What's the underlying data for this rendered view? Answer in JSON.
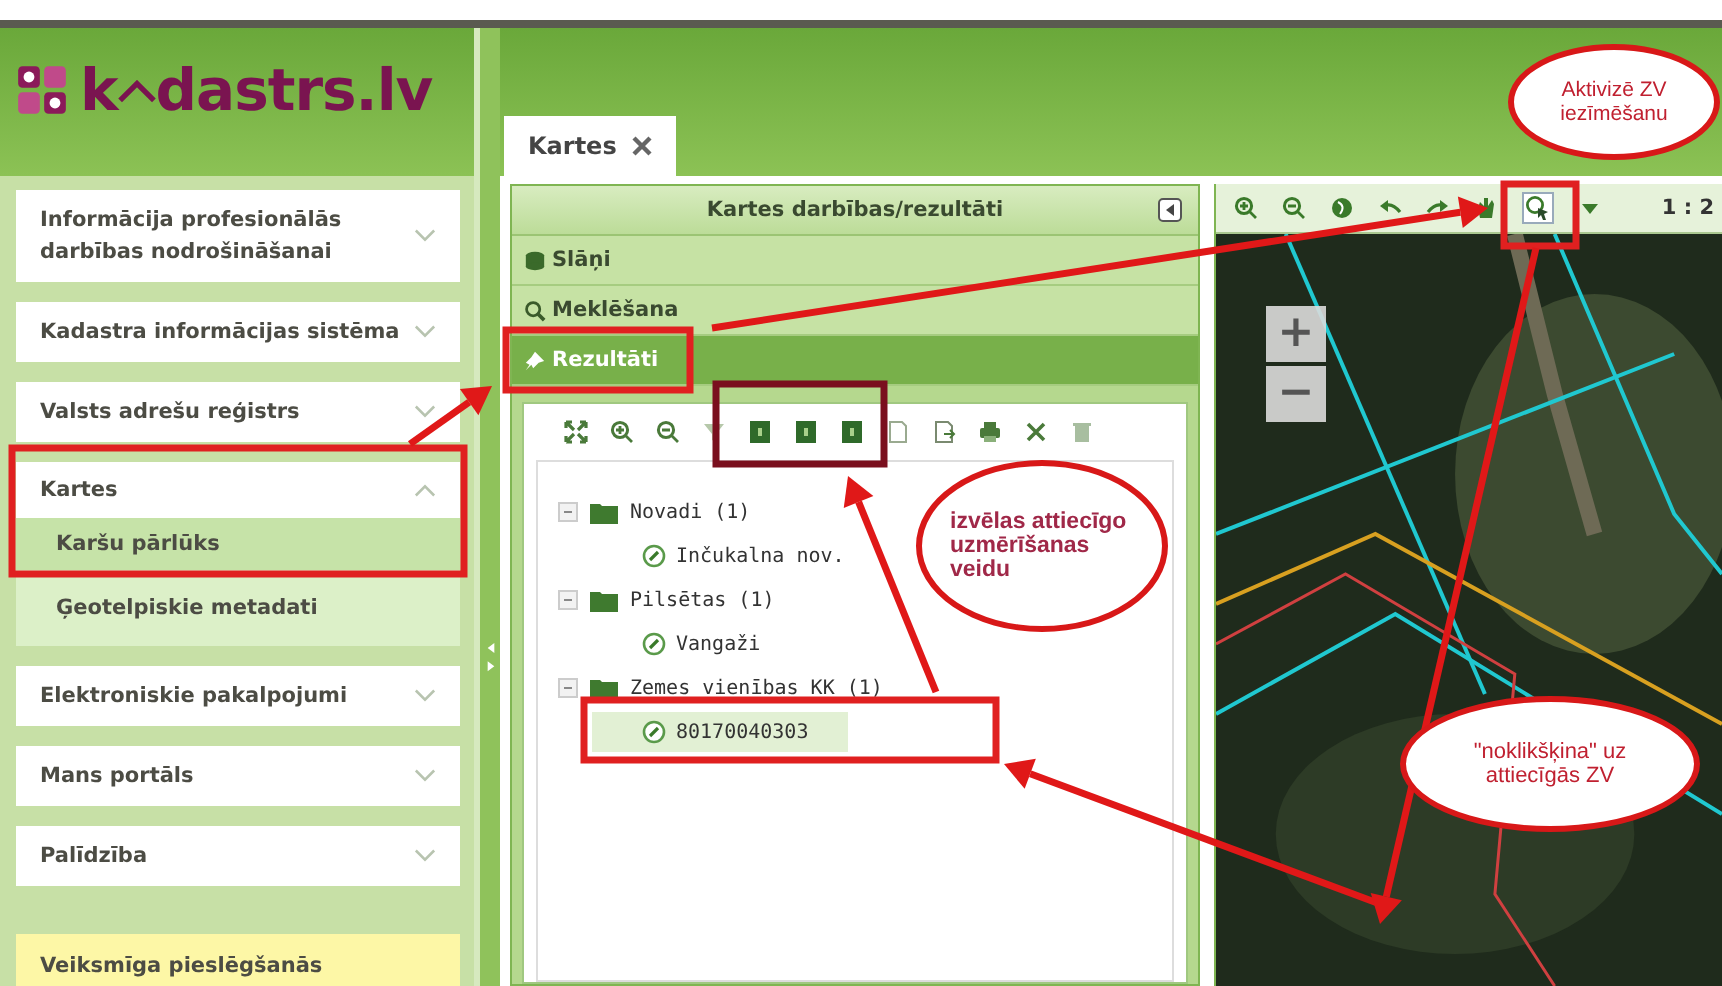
{
  "logo": {
    "before": "k",
    "after": "dastrs.lv"
  },
  "sidebar": {
    "items": [
      {
        "label": "Informācija profesionālās darbības nodrošināšanai",
        "expanded": false
      },
      {
        "label": "Kadastra informācijas sistēma",
        "expanded": false
      },
      {
        "label": "Valsts adrešu reģistrs",
        "expanded": false
      },
      {
        "label": "Kartes",
        "expanded": true,
        "children": [
          {
            "label": "Karšu pārlūks",
            "selected": true
          },
          {
            "label": "Ģeotelpiskie metadati",
            "selected": false
          }
        ]
      },
      {
        "label": "Elektroniskie pakalpojumi",
        "expanded": false
      },
      {
        "label": "Mans portāls",
        "expanded": false
      },
      {
        "label": "Palīdzība",
        "expanded": false
      }
    ],
    "notice": "Veiksmīga pieslēgšanās"
  },
  "tabs": [
    {
      "label": "Kartes",
      "selected": true
    }
  ],
  "results_panel": {
    "title": "Kartes darbības/rezultāti",
    "sections": [
      {
        "label": "Slāņi",
        "selected": false
      },
      {
        "label": "Meklēšana",
        "selected": false
      },
      {
        "label": "Rezultāti",
        "selected": true
      }
    ],
    "tree": [
      {
        "label": "Novadi (1)",
        "expanded": true,
        "children": [
          {
            "label": "Inčukalna nov.",
            "selected": false
          }
        ]
      },
      {
        "label": "Pilsētas (1)",
        "expanded": true,
        "children": [
          {
            "label": "Vangaži",
            "selected": false
          }
        ]
      },
      {
        "label": "Zemes vienības KK (1)",
        "expanded": true,
        "children": [
          {
            "label": "80170040303",
            "selected": true
          }
        ]
      }
    ]
  },
  "map": {
    "scale": "1 : 2",
    "zoom_in": "+",
    "zoom_out": "−"
  },
  "annotations": [
    {
      "text": "Aktivizē ZV iezīmēšanu"
    },
    {
      "text": "izvēlas attiecīgo uzmērīšanas veidu"
    },
    {
      "text": "\"noklikšķina\" uz attiecīgās ZV"
    }
  ]
}
